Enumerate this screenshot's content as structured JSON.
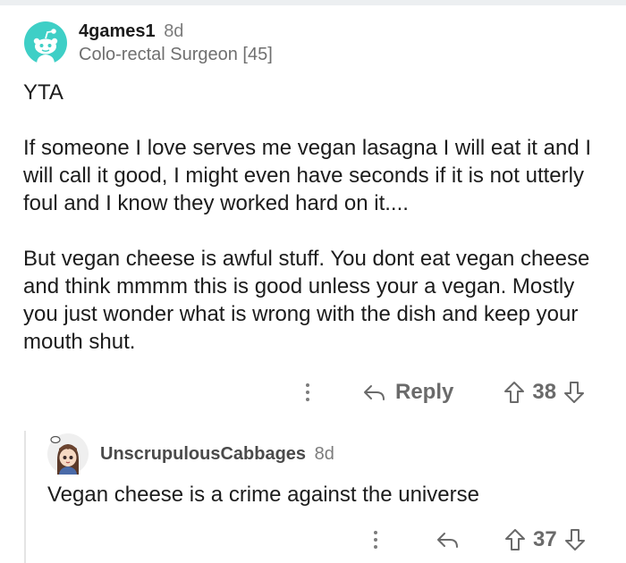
{
  "comment": {
    "author": "4games1",
    "age": "8d",
    "flair": "Colo-rectal Surgeon [45]",
    "paragraphs": [
      "YTA",
      "If someone I love serves me vegan lasagna I will eat it and I will call it good, I might even have seconds if it is not utterly foul and I know they worked hard on it....",
      "But vegan cheese is awful stuff. You dont eat vegan cheese and think mmmm this is good unless your a vegan. Mostly you just wonder what is wrong with the dish and keep your mouth shut."
    ],
    "actions": {
      "more_icon": "more-vertical-icon",
      "reply_label": "Reply",
      "reply_icon": "reply-arrow-icon",
      "score": "38"
    }
  },
  "reply": {
    "author": "UnscrupulousCabbages",
    "age": "8d",
    "body": "Vegan cheese is a crime against the universe",
    "actions": {
      "more_icon": "more-vertical-icon",
      "reply_icon": "reply-arrow-icon",
      "score": "37"
    }
  },
  "colors": {
    "avatar_bg": "#3ecfc6",
    "text": "#1c1c1c",
    "meta": "#7c7c7c",
    "action": "#6a6a6a"
  }
}
